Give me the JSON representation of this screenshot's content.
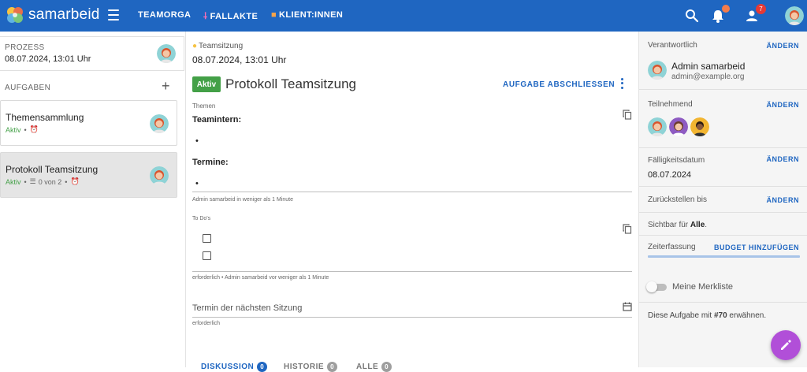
{
  "app": {
    "name": "samarbeid"
  },
  "nav": {
    "teamorga": "TEAMORGA",
    "fallakte": "FALLAKTE",
    "klient": "KLIENT:INNEN",
    "notifications_badge": "",
    "users_badge": "7"
  },
  "left": {
    "process_label": "PROZESS",
    "process_date": "08.07.2024, 13:01 Uhr",
    "tasks_label": "AUFGABEN",
    "add_symbol": "+",
    "tasks": [
      {
        "title": "Themensammlung",
        "status": "Aktiv",
        "sep": "•"
      },
      {
        "title": "Protokoll Teamsitzung",
        "status": "Aktiv",
        "sep": "•",
        "checklist": "0 von 2"
      }
    ]
  },
  "main": {
    "breadcrumb": "Teamsitzung",
    "date": "08.07.2024, 13:01 Uhr",
    "status_chip": "Aktiv",
    "title": "Protokoll Teamsitzung",
    "complete_action": "AUFGABE ABSCHLIESSEN",
    "themen": {
      "label": "Themen",
      "heading1": "Teamintern:",
      "bullet1": "•",
      "heading2": "Termine:",
      "bullet2": "•",
      "footer": "Admin samarbeid in weniger als 1 Minute"
    },
    "todos": {
      "label": "To Do's",
      "footer": "erforderlich • Admin samarbeid vor weniger als 1 Minute"
    },
    "termin": {
      "placeholder": "Termin der nächsten Sitzung",
      "footer": "erforderlich"
    },
    "tabs": [
      {
        "label": "DISKUSSION",
        "count": "0"
      },
      {
        "label": "HISTORIE",
        "count": "0"
      },
      {
        "label": "ALLE",
        "count": "0"
      }
    ]
  },
  "right": {
    "responsible_label": "Verantwortlich",
    "change": "ÄNDERN",
    "admin_name": "Admin samarbeid",
    "admin_email": "admin@example.org",
    "participants_label": "Teilnehmend",
    "due_label": "Fälligkeitsdatum",
    "due_date": "08.07.2024",
    "defer_label": "Zurückstellen bis",
    "visible_prefix": "Sichtbar für",
    "visible_value": "Alle",
    "visible_suffix": ".",
    "time_label": "Zeiterfassung",
    "budget_action": "BUDGET HINZUFÜGEN",
    "bookmark_label": "Meine Merkliste",
    "mention_prefix": "Diese Aufgabe mit",
    "mention_ref": "#70",
    "mention_suffix": "erwähnen."
  },
  "colors": {
    "primary": "#1f66c1",
    "active_green": "#43a047",
    "fab": "#b14fd8",
    "badge_orange": "#f57c4b",
    "badge_red": "#e53935"
  }
}
